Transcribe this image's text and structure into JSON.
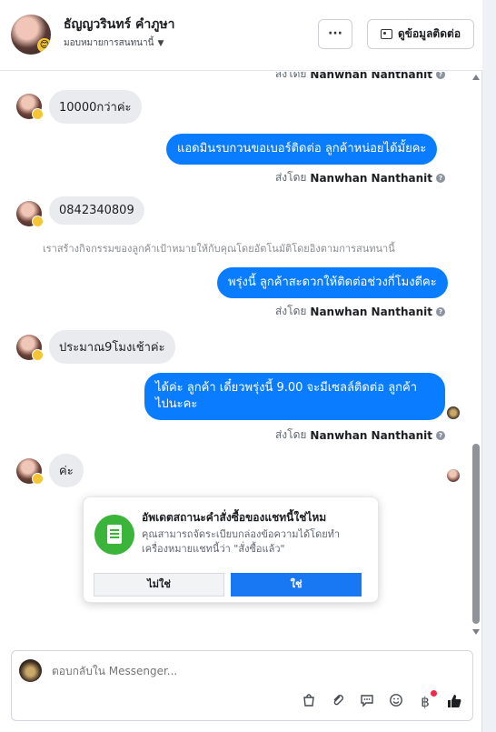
{
  "header": {
    "contact_name": "ธัญญวรินทร์ คำภูษา",
    "assign_label": "มอบหมายการสนทนานี้",
    "more_label": "···",
    "view_contact_label": "ดูข้อมูลติดต่อ"
  },
  "messages": {
    "top_sent_by_prefix": "ส่งโดย",
    "top_sent_by_name": "Nanwhan Nanthanit",
    "m1": "10000กว่าค่ะ",
    "m2": "แอดมินรบกวนขอเบอร์ติดต่อ ลูกค้าหน่อยได้มั้ยคะ",
    "m2_sent_by_prefix": "ส่งโดย",
    "m2_sent_by_name": "Nanwhan Nanthanit",
    "m3": "0842340809",
    "system_note": "เราสร้างกิจกรรมของลูกค้าเป้าหมายให้กับคุณโดยอัตโนมัติโดยอิงตามการสนทนานี้",
    "m4": "พรุ่งนี้ ลูกค้าสะดวกให้ติดต่อช่วงกี่โมงดีคะ",
    "m4_sent_by_prefix": "ส่งโดย",
    "m4_sent_by_name": "Nanwhan Nanthanit",
    "m5": "ประมาณ9โมงเช้าค่ะ",
    "m6_line1": "ได้ค่ะ ลูกค้า  เดี๋ยวพรุ่งนี้ 9.00 จะมีเซลล์ติดต่อ ลูกค้า",
    "m6_line2": "ไปนะคะ",
    "m6_sent_by_prefix": "ส่งโดย",
    "m6_sent_by_name": "Nanwhan Nanthanit",
    "m7": "ค่ะ"
  },
  "popup": {
    "title": "อัพเดตสถานะคำสั่งซื้อของแชทนี้ใช่ไหม",
    "body": "คุณสามารถจัดระเบียบกล่องข้อความได้โดยทำเครื่องหมายแชทนี้ว่า \"สั่งซื้อแล้ว\"",
    "no_label": "ไม่ใช่",
    "yes_label": "ใช่"
  },
  "composer": {
    "placeholder": "ตอบกลับใน Messenger..."
  },
  "icons": {
    "more": "more-dots-icon",
    "contact": "contact-card-icon",
    "bag": "shopping-bag-icon",
    "attach": "paperclip-icon",
    "saved_replies": "chat-bubble-icon",
    "emoji": "smiley-icon",
    "currency": "baht-icon",
    "like": "thumbs-up-icon"
  },
  "colors": {
    "outgoing_bubble": "#0a7cff",
    "incoming_bubble": "#e9ebee",
    "primary_button": "#1877f2",
    "popup_icon_bg": "#3bb43a"
  }
}
